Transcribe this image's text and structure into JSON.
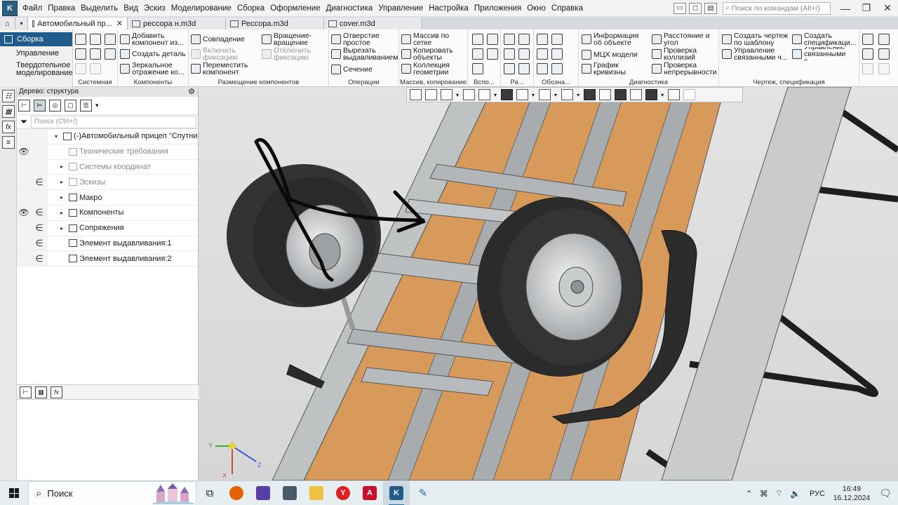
{
  "menubar": {
    "items": [
      "Файл",
      "Правка",
      "Выделить",
      "Вид",
      "Эскиз",
      "Моделирование",
      "Сборка",
      "Оформление",
      "Диагностика",
      "Управление",
      "Настройка",
      "Приложения",
      "Окно",
      "Справка"
    ],
    "search_placeholder": "Поиск по командам (Alt+/)"
  },
  "tabs": [
    {
      "label": "Автомобильный пр...",
      "active": true
    },
    {
      "label": "рессора н.m3d",
      "active": false
    },
    {
      "label": "Рессора.m3d",
      "active": false
    },
    {
      "label": "cover.m3d",
      "active": false
    }
  ],
  "ribbon": {
    "modes": [
      "Сборка",
      "Управление",
      "Твердотельное моделирование"
    ],
    "groups": {
      "system": "Системная",
      "components": "Компоненты",
      "placement": "Размещение компонентов",
      "operations": "Операции",
      "array": "Массив, копирование",
      "aux": "Вспо...",
      "ra": "Ра...",
      "design": "Обозна...",
      "diagnostics": "Диагностика",
      "drawing": "Чертеж, спецификация"
    },
    "buttons": {
      "add_component": "Добавить компонент из...",
      "create_part": "Создать деталь",
      "mirror": "Зеркальное отражение ко...",
      "coincidence": "Совпадение",
      "enable_fix": "Включить фиксацию",
      "move_component": "Переместить компонент",
      "rotation": "Вращение-вращение",
      "disable_fix": "Отключить фиксацию",
      "hole_simple": "Отверстие простое",
      "cut_extrude": "Вырезать выдавливанием",
      "section": "Сечение",
      "grid_array": "Массив по сетке",
      "copy_objects": "Копировать объекты",
      "geom_collection": "Коллекция геометрии",
      "object_info": "Информация об объекте",
      "mass_props": "МЦХ модели",
      "curvature": "График кривизны",
      "distance": "Расстояние и угол",
      "collisions": "Проверка коллизий",
      "continuity": "Проверка непрерывности",
      "drawing_template": "Создать чертеж по шаблону",
      "linked_mgmt": "Управление связанными ч...",
      "create_spec": "Создать спецификаци...",
      "linked_spec": "Управление связанными с..."
    }
  },
  "tree": {
    "title": "Дерево: структура",
    "search_placeholder": "Поиск (Ctrl+/)",
    "rows": [
      {
        "label": "(-)Автомобильный прицеп \"Спутни",
        "c1": "",
        "c2": "",
        "dim": false,
        "level": 0,
        "arrow": "▾"
      },
      {
        "label": "Технические требования",
        "c1": "👁",
        "c2": "",
        "dim": true,
        "level": 1,
        "arrow": ""
      },
      {
        "label": "Системы координат",
        "c1": "",
        "c2": "",
        "dim": true,
        "level": 1,
        "arrow": "▸"
      },
      {
        "label": "Эскизы",
        "c1": "",
        "c2": "∈",
        "dim": true,
        "level": 1,
        "arrow": "▸"
      },
      {
        "label": "Макро",
        "c1": "",
        "c2": "",
        "dim": false,
        "level": 1,
        "arrow": "▸"
      },
      {
        "label": "Компоненты",
        "c1": "👁",
        "c2": "∈",
        "dim": false,
        "level": 1,
        "arrow": "▸"
      },
      {
        "label": "Сопряжения",
        "c1": "",
        "c2": "∈",
        "dim": false,
        "level": 1,
        "arrow": "▸"
      },
      {
        "label": "Элемент выдавливания:1",
        "c1": "",
        "c2": "∈",
        "dim": false,
        "level": 1,
        "arrow": ""
      },
      {
        "label": "Элемент выдавливания:2",
        "c1": "",
        "c2": "∈",
        "dim": false,
        "level": 1,
        "arrow": ""
      }
    ]
  },
  "triad": {
    "x": "X",
    "y": "Y",
    "z": "Z"
  },
  "taskbar": {
    "search": "Поиск",
    "lang": "РУС",
    "time": "16:49",
    "date": "16.12.2024"
  },
  "colors": {
    "accent": "#1f5c8b",
    "wood": "#d89a57",
    "steel": "#b9bcbe",
    "tire": "#2a2a2a"
  }
}
